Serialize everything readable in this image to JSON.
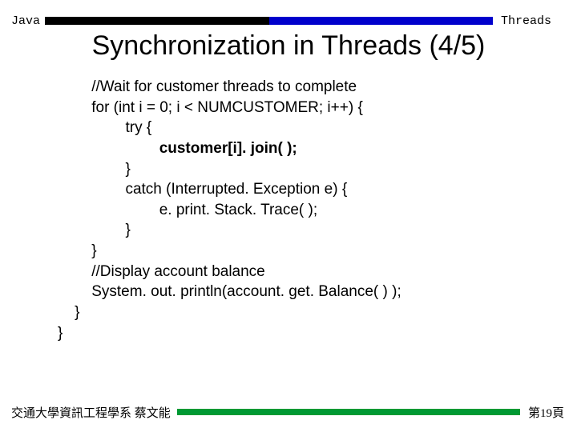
{
  "header": {
    "left": "Java",
    "right": "Threads"
  },
  "title": "Synchronization in Threads (4/5)",
  "code": {
    "l1": "        //Wait for customer threads to complete",
    "l2": "        for (int i = 0; i < NUMCUSTOMER; i++) {",
    "l3": "                try {",
    "l4": "                        customer[i]. join( );",
    "l5": "                }",
    "l6": "                catch (Interrupted. Exception e) {",
    "l7": "                        e. print. Stack. Trace( );",
    "l8": "                }",
    "l9": "        }",
    "l10": "        //Display account balance",
    "l11": "        System. out. println(account. get. Balance( ) );",
    "l12": "    }",
    "l13": "}"
  },
  "footer": {
    "left": "交通大學資訊工程學系 蔡文能",
    "right": "第19頁"
  }
}
